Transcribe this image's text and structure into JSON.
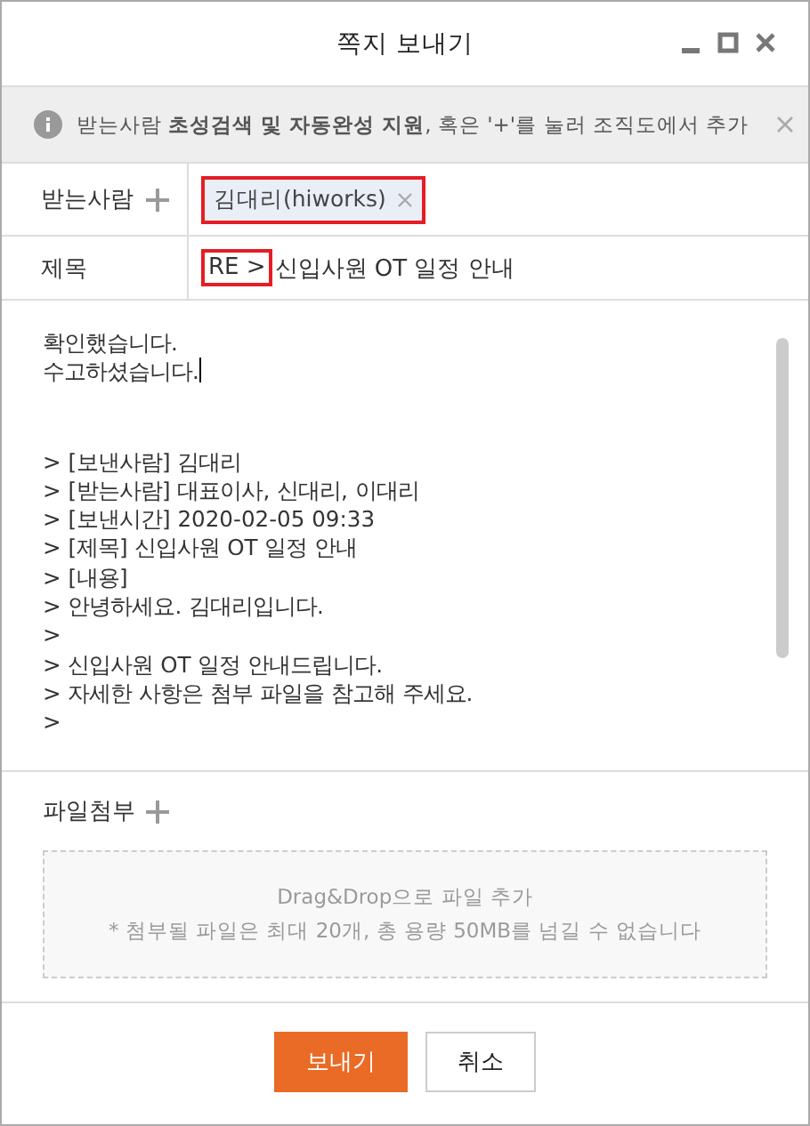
{
  "window": {
    "title": "쪽지 보내기"
  },
  "notice": {
    "text": "받는사람 **초성검색 및 자동완성 지원**, 혹은 '+'를 눌러 조직도에서 추가"
  },
  "recipients": {
    "label": "받는사람",
    "chips": [
      {
        "text": "김대리(hiworks)",
        "highlighted": true
      }
    ]
  },
  "subject": {
    "label": "제목",
    "prefix": "RE >",
    "prefix_highlighted": true,
    "value": "신입사원 OT 일정 안내"
  },
  "body": {
    "reply": [
      {
        "text": "확인했습니다.",
        "cursor": false
      },
      {
        "text": "수고하셨습니다.",
        "cursor": true
      }
    ],
    "quoted": [
      "> [보낸사람] 김대리",
      "> [받는사람] 대표이사, 신대리, 이대리",
      "> [보낸시간] 2020-02-05 09:33",
      "> [제목] 신입사원 OT 일정 안내",
      "> [내용]",
      "> 안녕하세요. 김대리입니다.",
      ">",
      "> 신입사원 OT 일정 안내드립니다.",
      "> 자세한 사항은 첨부 파일을 참고해 주세요.",
      ">"
    ]
  },
  "attachments": {
    "label": "파일첨부",
    "drop_title": "Drag&Drop으로 파일 추가",
    "drop_note": "* 첨부될 파일은 최대 20개, 총 용량 50MB를 넘길 수 없습니다"
  },
  "buttons": [
    {
      "label": "보내기",
      "kind": "primary"
    },
    {
      "label": "취소",
      "kind": "secondary"
    }
  ]
}
